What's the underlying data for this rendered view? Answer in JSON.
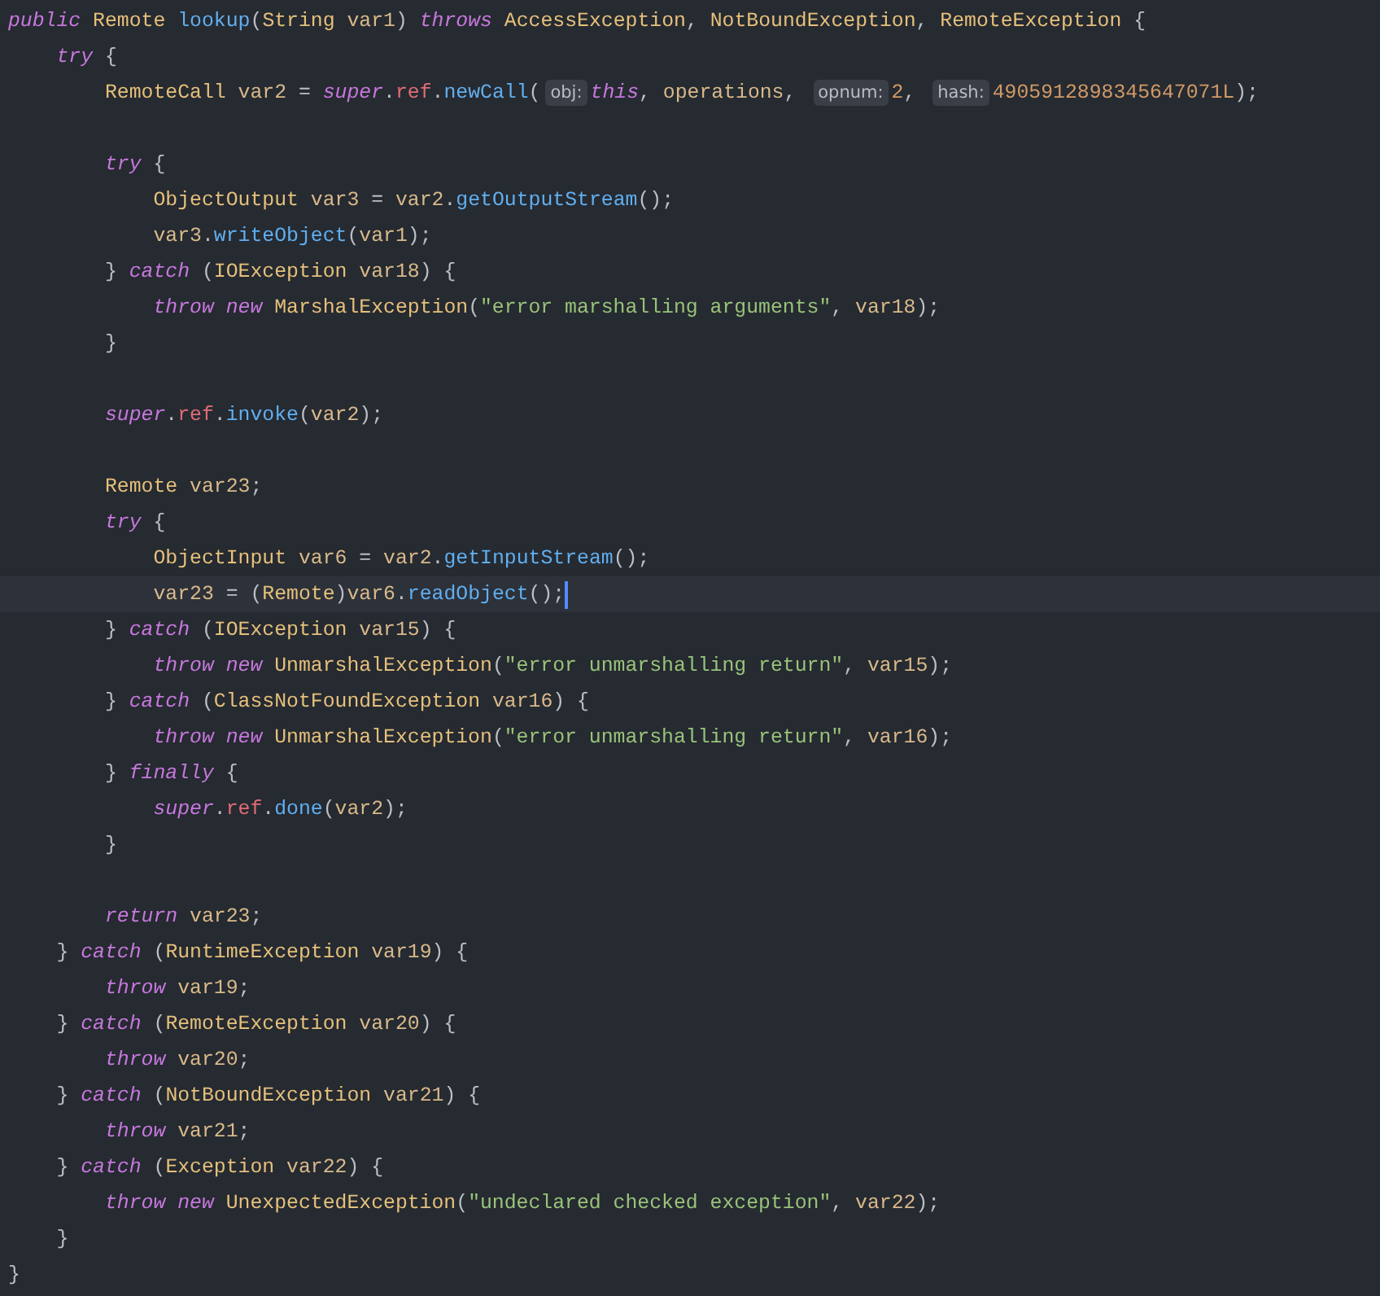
{
  "editor": {
    "lines": [
      {
        "kind": "code",
        "current": false,
        "tokens": [
          {
            "kind": "kw",
            "text": "public"
          },
          {
            "kind": "type",
            "text": " Remote "
          },
          {
            "kind": "fn",
            "text": "lookup"
          },
          {
            "kind": "plain",
            "text": "("
          },
          {
            "kind": "type",
            "text": "String"
          },
          {
            "kind": "var",
            "text": " var1"
          },
          {
            "kind": "plain",
            "text": ") "
          },
          {
            "kind": "kw",
            "text": "throws"
          },
          {
            "kind": "type",
            "text": " AccessException"
          },
          {
            "kind": "plain",
            "text": ", "
          },
          {
            "kind": "type",
            "text": "NotBoundException"
          },
          {
            "kind": "plain",
            "text": ", "
          },
          {
            "kind": "type",
            "text": "RemoteException"
          },
          {
            "kind": "plain",
            "text": " {"
          }
        ]
      },
      {
        "kind": "code",
        "current": false,
        "tokens": [
          {
            "kind": "kw",
            "text": "    try"
          },
          {
            "kind": "plain",
            "text": " {"
          }
        ]
      },
      {
        "kind": "code",
        "current": false,
        "tokens": [
          {
            "kind": "type",
            "text": "        RemoteCall"
          },
          {
            "kind": "var",
            "text": " var2"
          },
          {
            "kind": "plain",
            "text": " = "
          },
          {
            "kind": "kw",
            "text": "super"
          },
          {
            "kind": "plain",
            "text": "."
          },
          {
            "kind": "field",
            "text": "ref"
          },
          {
            "kind": "plain",
            "text": "."
          },
          {
            "kind": "fn",
            "text": "newCall"
          },
          {
            "kind": "plain",
            "text": "("
          },
          {
            "kind": "hint",
            "text": "obj:"
          },
          {
            "kind": "kw",
            "text": "this"
          },
          {
            "kind": "plain",
            "text": ", "
          },
          {
            "kind": "var",
            "text": "operations"
          },
          {
            "kind": "plain",
            "text": ", "
          },
          {
            "kind": "hint",
            "text": "opnum:"
          },
          {
            "kind": "num",
            "text": "2"
          },
          {
            "kind": "plain",
            "text": ", "
          },
          {
            "kind": "hint",
            "text": "hash:"
          },
          {
            "kind": "num",
            "text": "4905912898345647071L"
          },
          {
            "kind": "plain",
            "text": ");"
          }
        ]
      },
      {
        "kind": "blank"
      },
      {
        "kind": "code",
        "current": false,
        "tokens": [
          {
            "kind": "kw",
            "text": "        try"
          },
          {
            "kind": "plain",
            "text": " {"
          }
        ]
      },
      {
        "kind": "code",
        "current": false,
        "tokens": [
          {
            "kind": "type",
            "text": "            ObjectOutput"
          },
          {
            "kind": "var",
            "text": " var3"
          },
          {
            "kind": "plain",
            "text": " = "
          },
          {
            "kind": "var",
            "text": "var2"
          },
          {
            "kind": "plain",
            "text": "."
          },
          {
            "kind": "fn",
            "text": "getOutputStream"
          },
          {
            "kind": "plain",
            "text": "();"
          }
        ]
      },
      {
        "kind": "code",
        "current": false,
        "tokens": [
          {
            "kind": "var",
            "text": "            var3"
          },
          {
            "kind": "plain",
            "text": "."
          },
          {
            "kind": "fn",
            "text": "writeObject"
          },
          {
            "kind": "plain",
            "text": "("
          },
          {
            "kind": "var",
            "text": "var1"
          },
          {
            "kind": "plain",
            "text": ");"
          }
        ]
      },
      {
        "kind": "code",
        "current": false,
        "tokens": [
          {
            "kind": "plain",
            "text": "        } "
          },
          {
            "kind": "kw",
            "text": "catch"
          },
          {
            "kind": "plain",
            "text": " ("
          },
          {
            "kind": "type",
            "text": "IOException"
          },
          {
            "kind": "var",
            "text": " var18"
          },
          {
            "kind": "plain",
            "text": ") {"
          }
        ]
      },
      {
        "kind": "code",
        "current": false,
        "tokens": [
          {
            "kind": "kw",
            "text": "            throw new"
          },
          {
            "kind": "type",
            "text": " MarshalException"
          },
          {
            "kind": "plain",
            "text": "("
          },
          {
            "kind": "str",
            "text": "\"error marshalling arguments\""
          },
          {
            "kind": "plain",
            "text": ", "
          },
          {
            "kind": "var",
            "text": "var18"
          },
          {
            "kind": "plain",
            "text": ");"
          }
        ]
      },
      {
        "kind": "code",
        "current": false,
        "tokens": [
          {
            "kind": "plain",
            "text": "        }"
          }
        ]
      },
      {
        "kind": "blank"
      },
      {
        "kind": "code",
        "current": false,
        "tokens": [
          {
            "kind": "kw",
            "text": "        super"
          },
          {
            "kind": "plain",
            "text": "."
          },
          {
            "kind": "field",
            "text": "ref"
          },
          {
            "kind": "plain",
            "text": "."
          },
          {
            "kind": "fn",
            "text": "invoke"
          },
          {
            "kind": "plain",
            "text": "("
          },
          {
            "kind": "var",
            "text": "var2"
          },
          {
            "kind": "plain",
            "text": ");"
          }
        ]
      },
      {
        "kind": "blank"
      },
      {
        "kind": "code",
        "current": false,
        "tokens": [
          {
            "kind": "type",
            "text": "        Remote"
          },
          {
            "kind": "var",
            "text": " var23"
          },
          {
            "kind": "plain",
            "text": ";"
          }
        ]
      },
      {
        "kind": "code",
        "current": false,
        "tokens": [
          {
            "kind": "kw",
            "text": "        try"
          },
          {
            "kind": "plain",
            "text": " {"
          }
        ]
      },
      {
        "kind": "code",
        "current": false,
        "tokens": [
          {
            "kind": "type",
            "text": "            ObjectInput"
          },
          {
            "kind": "var",
            "text": " var6"
          },
          {
            "kind": "plain",
            "text": " = "
          },
          {
            "kind": "var",
            "text": "var2"
          },
          {
            "kind": "plain",
            "text": "."
          },
          {
            "kind": "fn",
            "text": "getInputStream"
          },
          {
            "kind": "plain",
            "text": "();"
          }
        ]
      },
      {
        "kind": "code",
        "current": true,
        "tokens": [
          {
            "kind": "var",
            "text": "            var23"
          },
          {
            "kind": "plain",
            "text": " = ("
          },
          {
            "kind": "type",
            "text": "Remote"
          },
          {
            "kind": "plain",
            "text": ")"
          },
          {
            "kind": "var",
            "text": "var6"
          },
          {
            "kind": "plain",
            "text": "."
          },
          {
            "kind": "fn",
            "text": "readObject"
          },
          {
            "kind": "plain",
            "text": "();"
          }
        ]
      },
      {
        "kind": "code",
        "current": false,
        "tokens": [
          {
            "kind": "plain",
            "text": "        } "
          },
          {
            "kind": "kw",
            "text": "catch"
          },
          {
            "kind": "plain",
            "text": " ("
          },
          {
            "kind": "type",
            "text": "IOException"
          },
          {
            "kind": "var",
            "text": " var15"
          },
          {
            "kind": "plain",
            "text": ") {"
          }
        ]
      },
      {
        "kind": "code",
        "current": false,
        "tokens": [
          {
            "kind": "kw",
            "text": "            throw new"
          },
          {
            "kind": "type",
            "text": " UnmarshalException"
          },
          {
            "kind": "plain",
            "text": "("
          },
          {
            "kind": "str",
            "text": "\"error unmarshalling return\""
          },
          {
            "kind": "plain",
            "text": ", "
          },
          {
            "kind": "var",
            "text": "var15"
          },
          {
            "kind": "plain",
            "text": ");"
          }
        ]
      },
      {
        "kind": "code",
        "current": false,
        "tokens": [
          {
            "kind": "plain",
            "text": "        } "
          },
          {
            "kind": "kw",
            "text": "catch"
          },
          {
            "kind": "plain",
            "text": " ("
          },
          {
            "kind": "type",
            "text": "ClassNotFoundException"
          },
          {
            "kind": "var",
            "text": " var16"
          },
          {
            "kind": "plain",
            "text": ") {"
          }
        ]
      },
      {
        "kind": "code",
        "current": false,
        "tokens": [
          {
            "kind": "kw",
            "text": "            throw new"
          },
          {
            "kind": "type",
            "text": " UnmarshalException"
          },
          {
            "kind": "plain",
            "text": "("
          },
          {
            "kind": "str",
            "text": "\"error unmarshalling return\""
          },
          {
            "kind": "plain",
            "text": ", "
          },
          {
            "kind": "var",
            "text": "var16"
          },
          {
            "kind": "plain",
            "text": ");"
          }
        ]
      },
      {
        "kind": "code",
        "current": false,
        "tokens": [
          {
            "kind": "plain",
            "text": "        } "
          },
          {
            "kind": "kw",
            "text": "finally"
          },
          {
            "kind": "plain",
            "text": " {"
          }
        ]
      },
      {
        "kind": "code",
        "current": false,
        "tokens": [
          {
            "kind": "kw",
            "text": "            super"
          },
          {
            "kind": "plain",
            "text": "."
          },
          {
            "kind": "field",
            "text": "ref"
          },
          {
            "kind": "plain",
            "text": "."
          },
          {
            "kind": "fn",
            "text": "done"
          },
          {
            "kind": "plain",
            "text": "("
          },
          {
            "kind": "var",
            "text": "var2"
          },
          {
            "kind": "plain",
            "text": ");"
          }
        ]
      },
      {
        "kind": "code",
        "current": false,
        "tokens": [
          {
            "kind": "plain",
            "text": "        }"
          }
        ]
      },
      {
        "kind": "blank"
      },
      {
        "kind": "code",
        "current": false,
        "tokens": [
          {
            "kind": "kw",
            "text": "        return"
          },
          {
            "kind": "var",
            "text": " var23"
          },
          {
            "kind": "plain",
            "text": ";"
          }
        ]
      },
      {
        "kind": "code",
        "current": false,
        "tokens": [
          {
            "kind": "plain",
            "text": "    } "
          },
          {
            "kind": "kw",
            "text": "catch"
          },
          {
            "kind": "plain",
            "text": " ("
          },
          {
            "kind": "type",
            "text": "RuntimeException"
          },
          {
            "kind": "var",
            "text": " var19"
          },
          {
            "kind": "plain",
            "text": ") {"
          }
        ]
      },
      {
        "kind": "code",
        "current": false,
        "tokens": [
          {
            "kind": "kw",
            "text": "        throw"
          },
          {
            "kind": "var",
            "text": " var19"
          },
          {
            "kind": "plain",
            "text": ";"
          }
        ]
      },
      {
        "kind": "code",
        "current": false,
        "tokens": [
          {
            "kind": "plain",
            "text": "    } "
          },
          {
            "kind": "kw",
            "text": "catch"
          },
          {
            "kind": "plain",
            "text": " ("
          },
          {
            "kind": "type",
            "text": "RemoteException"
          },
          {
            "kind": "var",
            "text": " var20"
          },
          {
            "kind": "plain",
            "text": ") {"
          }
        ]
      },
      {
        "kind": "code",
        "current": false,
        "tokens": [
          {
            "kind": "kw",
            "text": "        throw"
          },
          {
            "kind": "var",
            "text": " var20"
          },
          {
            "kind": "plain",
            "text": ";"
          }
        ]
      },
      {
        "kind": "code",
        "current": false,
        "tokens": [
          {
            "kind": "plain",
            "text": "    } "
          },
          {
            "kind": "kw",
            "text": "catch"
          },
          {
            "kind": "plain",
            "text": " ("
          },
          {
            "kind": "type",
            "text": "NotBoundException"
          },
          {
            "kind": "var",
            "text": " var21"
          },
          {
            "kind": "plain",
            "text": ") {"
          }
        ]
      },
      {
        "kind": "code",
        "current": false,
        "tokens": [
          {
            "kind": "kw",
            "text": "        throw"
          },
          {
            "kind": "var",
            "text": " var21"
          },
          {
            "kind": "plain",
            "text": ";"
          }
        ]
      },
      {
        "kind": "code",
        "current": false,
        "tokens": [
          {
            "kind": "plain",
            "text": "    } "
          },
          {
            "kind": "kw",
            "text": "catch"
          },
          {
            "kind": "plain",
            "text": " ("
          },
          {
            "kind": "type",
            "text": "Exception"
          },
          {
            "kind": "var",
            "text": " var22"
          },
          {
            "kind": "plain",
            "text": ") {"
          }
        ]
      },
      {
        "kind": "code",
        "current": false,
        "tokens": [
          {
            "kind": "kw",
            "text": "        throw new"
          },
          {
            "kind": "type",
            "text": " UnexpectedException"
          },
          {
            "kind": "plain",
            "text": "("
          },
          {
            "kind": "str",
            "text": "\"undeclared checked exception\""
          },
          {
            "kind": "plain",
            "text": ", "
          },
          {
            "kind": "var",
            "text": "var22"
          },
          {
            "kind": "plain",
            "text": ");"
          }
        ]
      },
      {
        "kind": "code",
        "current": false,
        "tokens": [
          {
            "kind": "plain",
            "text": "    }"
          }
        ]
      },
      {
        "kind": "code",
        "current": false,
        "tokens": [
          {
            "kind": "plain",
            "text": "}"
          }
        ]
      }
    ]
  }
}
